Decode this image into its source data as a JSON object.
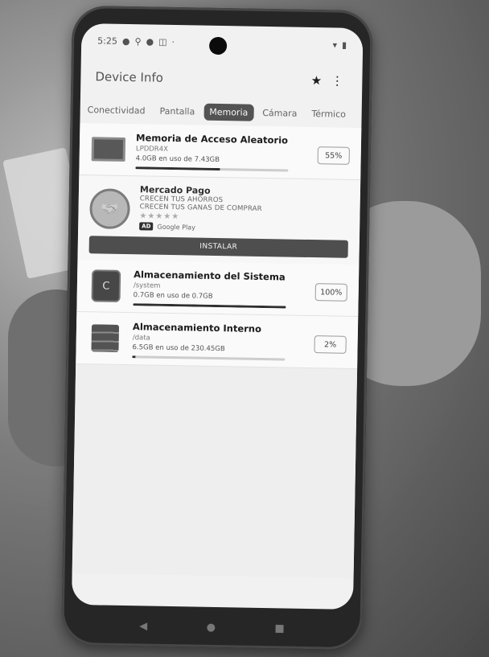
{
  "status_bar": {
    "time": "5:25",
    "left_icons": [
      "status-dot-icon",
      "location-icon",
      "status-dot-icon",
      "network-icon"
    ],
    "right_icons": [
      "wifi-icon",
      "battery-icon"
    ]
  },
  "app_bar": {
    "title": "Device Info",
    "star_icon": "★",
    "menu_icon": "⋮"
  },
  "tabs": [
    {
      "label": "Conectividad",
      "active": false
    },
    {
      "label": "Pantalla",
      "active": false
    },
    {
      "label": "Memoria",
      "active": true
    },
    {
      "label": "Cámara",
      "active": false
    },
    {
      "label": "Térmico",
      "active": false
    }
  ],
  "ram_card": {
    "title": "Memoria de Acceso Aleatorio",
    "subtitle": "LPDDR4X",
    "usage": "4.0GB en uso de 7.43GB",
    "percent": "55%",
    "percent_value": 55
  },
  "ad": {
    "title": "Mercado Pago",
    "line1": "CRECEN TUS AHORROS",
    "line2": "CRECEN TUS GANAS DE COMPRAR",
    "stars": "★★★★★",
    "badge": "AD",
    "source": "Google Play",
    "install_label": "INSTALAR"
  },
  "system_storage_card": {
    "title": "Almacenamiento del Sistema",
    "subtitle": "/system",
    "usage": "0.7GB en uso de 0.7GB",
    "percent": "100%",
    "percent_value": 100
  },
  "internal_storage_card": {
    "title": "Almacenamiento Interno",
    "subtitle": "/data",
    "usage": "6.5GB en uso de 230.45GB",
    "percent": "2%",
    "percent_value": 2
  },
  "nav_bar": {
    "back": "◀",
    "home": "●",
    "recents": "■"
  }
}
